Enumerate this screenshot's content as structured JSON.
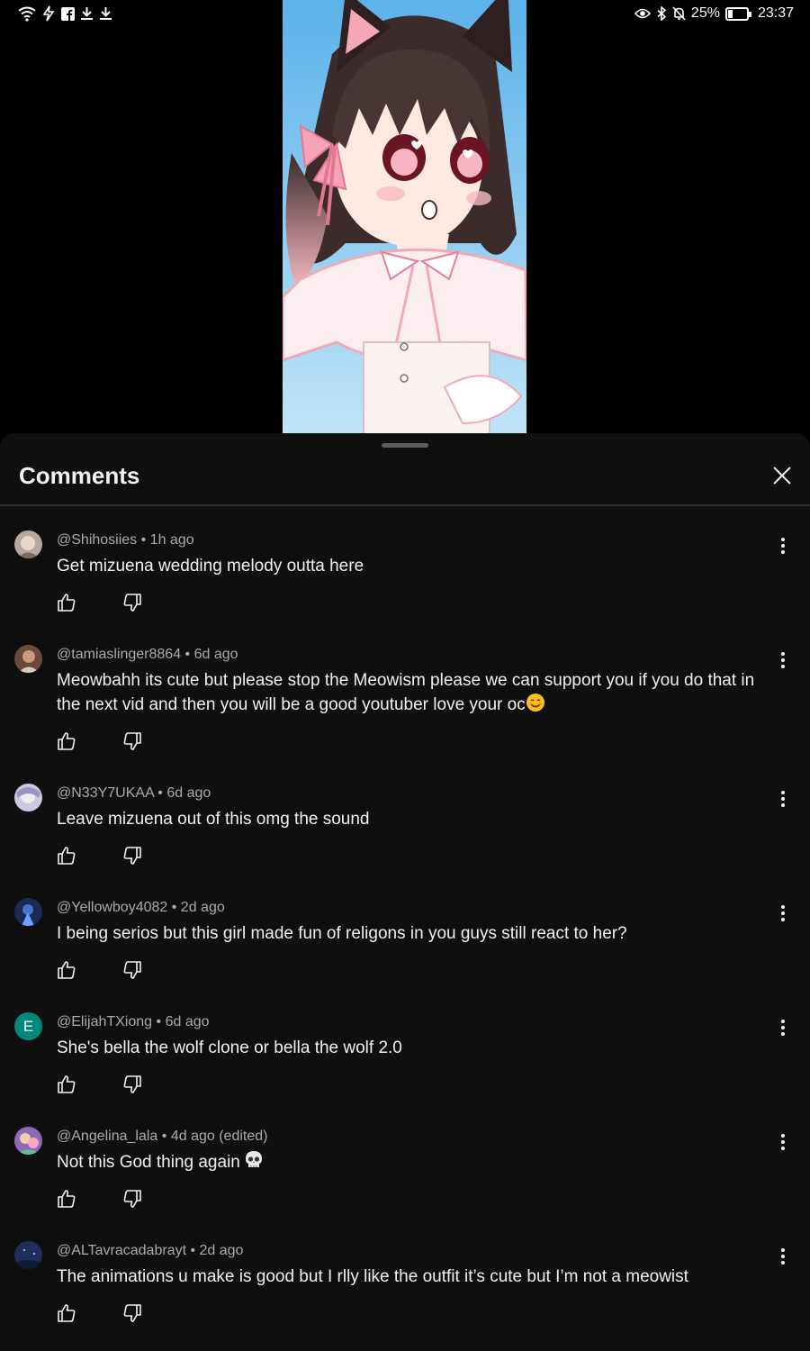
{
  "status_bar": {
    "battery": "25%",
    "battery_level": 0.25,
    "time": "23:37"
  },
  "sheet": {
    "title": "Comments"
  },
  "comments": [
    {
      "author": "@Shihosiies",
      "age": "1h ago",
      "text": "Get mizuena wedding melody outta here"
    },
    {
      "author": "@tamiaslinger8864",
      "age": "6d ago",
      "text": "Meowbahh its cute but please stop the Meowism please we can support you if you do that in the next vid and then you will be a good youtuber love your oc",
      "emoji": "smiling-face"
    },
    {
      "author": "@N33Y7UKAA",
      "age": "6d ago",
      "text": "Leave mizuena out of this omg the sound"
    },
    {
      "author": "@Yellowboy4082",
      "age": "2d ago",
      "text": "I being serios but this girl made fun of religons in you guys still react to her?"
    },
    {
      "author": "@ElijahTXiong",
      "age": "6d ago",
      "text": "She's bella the wolf clone or bella the wolf 2.0",
      "avatar_letter": "E"
    },
    {
      "author": "@Angelina_lala",
      "age": "4d ago (edited)",
      "text": "Not this God thing again",
      "emoji": "skull"
    },
    {
      "author": "@ALTavracadabrayt",
      "age": "2d ago",
      "text": "The animations u make is good but I rlly like the outfit it’s cute but I’m not a meowist"
    }
  ],
  "colors": {
    "background": "#0f0f0f",
    "primary_text": "#f1f1f1",
    "secondary_text": "#aaaaaa",
    "letter_avatar": "#00897b"
  }
}
